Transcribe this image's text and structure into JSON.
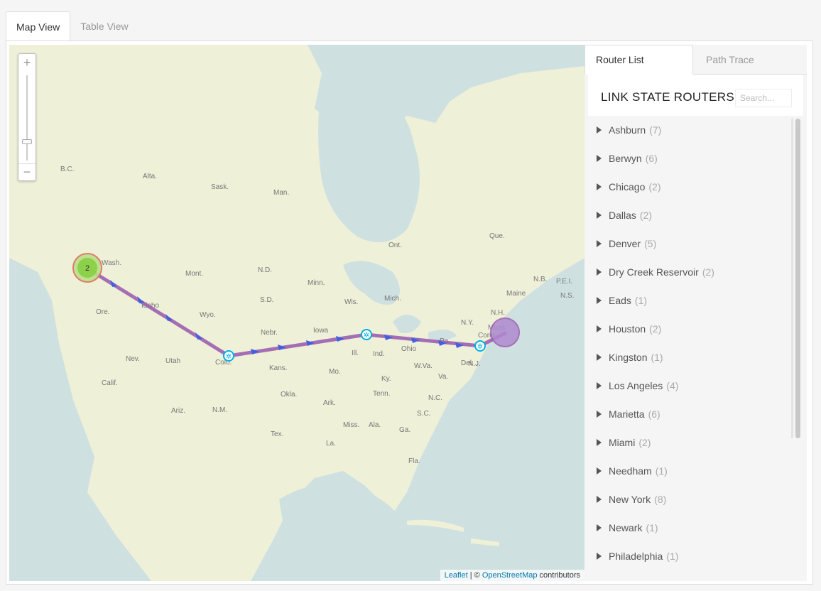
{
  "outer_tabs": [
    "Map View",
    "Table View"
  ],
  "map": {
    "zoom_in": "+",
    "zoom_out": "−",
    "cluster_count": "2",
    "attribution": {
      "leaflet": "Leaflet",
      "sep": " | © ",
      "osm": "OpenStreetMap",
      "suffix": " contributors"
    },
    "places": [
      "B.C.",
      "Alta.",
      "Sask.",
      "Man.",
      "Ont.",
      "Que.",
      "Wash.",
      "Mont.",
      "N.D.",
      "Minn.",
      "Ore.",
      "Idaho",
      "Wyo.",
      "S.D.",
      "Wis.",
      "Mich.",
      "N.Y.",
      "Maine",
      "N.B.",
      "P.E.I.",
      "N.S.",
      "N.H.",
      "Mass.",
      "Conn.",
      "Nebr.",
      "Iowa",
      "Ill.",
      "Ind.",
      "Ohio",
      "Pa.",
      "N.J.",
      "Del.",
      "Nev.",
      "Utah",
      "Colo.",
      "Kans.",
      "Mo.",
      "Ky.",
      "W.Va.",
      "Va.",
      "Calif.",
      "Okla.",
      "Tenn.",
      "N.C.",
      "Ariz.",
      "N.M.",
      "Ark.",
      "S.C.",
      "Tex.",
      "Miss.",
      "Ala.",
      "Ga.",
      "La.",
      "Fla."
    ],
    "colors": {
      "water": "#cfe0e1",
      "land": "#eef0d8",
      "path": "#9b5fb0",
      "arrow": "#4060e0",
      "cluster_green": "#8dd04a",
      "cluster_purple": "#b08ad0"
    }
  },
  "sidebar": {
    "tabs": [
      "Router List",
      "Path Trace"
    ],
    "title": "LINK STATE ROUTERS",
    "search_placeholder": "Search...",
    "routers": [
      {
        "name": "Ashburn",
        "count": "(7)"
      },
      {
        "name": "Berwyn",
        "count": "(6)"
      },
      {
        "name": "Chicago",
        "count": "(2)"
      },
      {
        "name": "Dallas",
        "count": "(2)"
      },
      {
        "name": "Denver",
        "count": "(5)"
      },
      {
        "name": "Dry Creek Reservoir",
        "count": "(2)"
      },
      {
        "name": "Eads",
        "count": "(1)"
      },
      {
        "name": "Houston",
        "count": "(2)"
      },
      {
        "name": "Kingston",
        "count": "(1)"
      },
      {
        "name": "Los Angeles",
        "count": "(4)"
      },
      {
        "name": "Marietta",
        "count": "(6)"
      },
      {
        "name": "Miami",
        "count": "(2)"
      },
      {
        "name": "Needham",
        "count": "(1)"
      },
      {
        "name": "New York",
        "count": "(8)"
      },
      {
        "name": "Newark",
        "count": "(1)"
      },
      {
        "name": "Philadelphia",
        "count": "(1)"
      }
    ]
  }
}
